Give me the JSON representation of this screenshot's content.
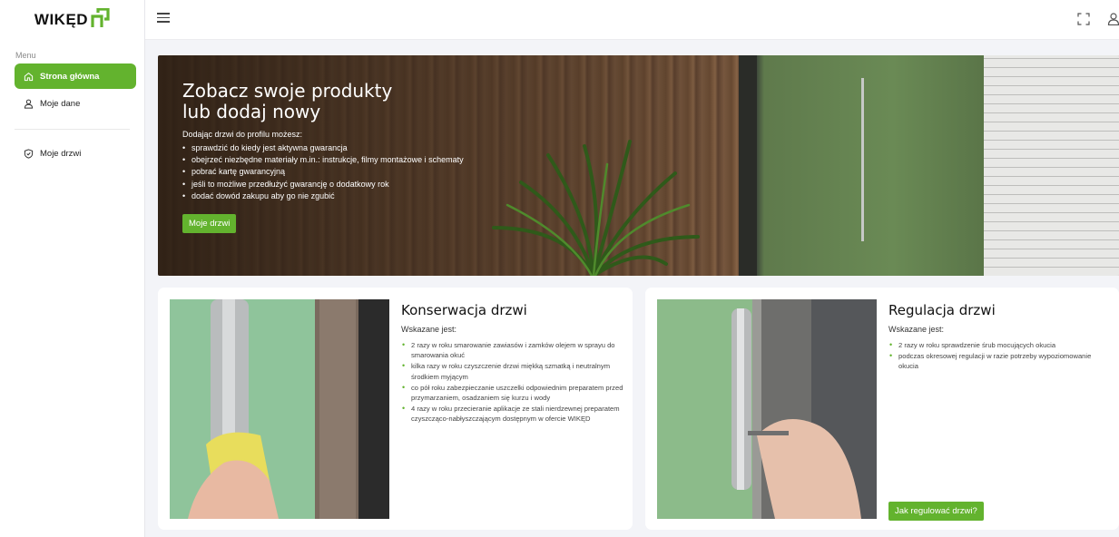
{
  "brand": {
    "logo_text": "WIKĘD",
    "accent": "#63b32e"
  },
  "sidebar": {
    "menu_label": "Menu",
    "items": [
      {
        "label": "Strona główna",
        "icon": "home-icon",
        "active": true
      },
      {
        "label": "Moje dane",
        "icon": "user-icon",
        "active": false
      },
      {
        "label": "Moje drzwi",
        "icon": "shield-check-icon",
        "active": false
      }
    ]
  },
  "topbar": {
    "icons": [
      "hamburger-icon",
      "fullscreen-icon",
      "user-icon"
    ]
  },
  "hero": {
    "title": "Zobacz swoje produkty lub dodaj nowy",
    "intro": "Dodając drzwi do profilu możesz:",
    "bullets": [
      "sprawdzić do kiedy jest aktywna gwarancja",
      "obejrzeć niezbędne materiały m.in.: instrukcje, filmy montażowe i schematy",
      "pobrać kartę gwarancyjną",
      "jeśli to możliwe przedłużyć gwarancję o dodatkowy rok",
      "dodać dowód zakupu aby go nie zgubić"
    ],
    "button_label": "Moje drzwi"
  },
  "cards": [
    {
      "title": "Konserwacja drzwi",
      "subtitle": "Wskazane jest:",
      "bullets": [
        "2 razy w roku smarowanie zawiasów i zamków olejem w sprayu do smarowania okuć",
        "kilka razy w roku czyszczenie drzwi miękką szmatką i neutralnym środkiem myjącym",
        "co pół roku zabezpieczanie uszczelki odpowiednim preparatem przed przymarzaniem, osadzaniem się kurzu i wody",
        "4 razy w roku przecieranie aplikacje ze stali nierdzewnej preparatem czyszcząco-nabłyszczającym dostępnym w ofercie WIKĘD"
      ]
    },
    {
      "title": "Regulacja drzwi",
      "subtitle": "Wskazane jest:",
      "bullets": [
        "2 razy w roku sprawdzenie śrub mocujących okucia",
        "podczas okresowej regulacji w razie potrzeby wypoziomowanie okucia"
      ],
      "button_label": "Jak regulować drzwi?"
    }
  ]
}
